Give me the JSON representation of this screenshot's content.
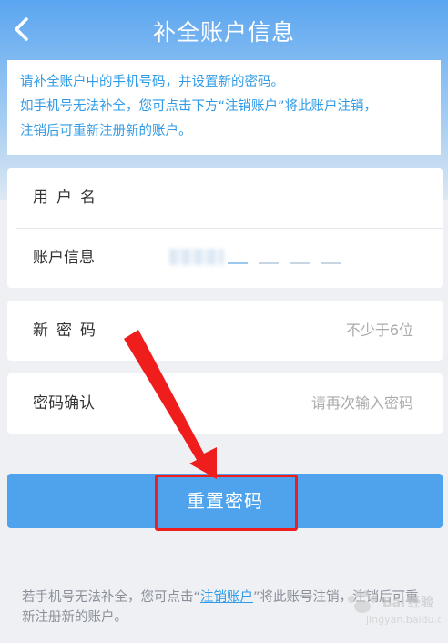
{
  "header": {
    "title": "补全账户信息",
    "back_icon": "chevron-left-icon"
  },
  "notice": {
    "lines": [
      "请补全账户中的手机号码，并设置新的密码。",
      "如手机号无法补全，您可点击下方“注销账户”将此账户注销，",
      "注销后可重新注册新的账户。"
    ]
  },
  "form": {
    "username_label": "用户名",
    "account_info_label": "账户信息",
    "new_password_label": "新密码",
    "new_password_placeholder": "不少于6位",
    "confirm_password_label": "密码确认",
    "confirm_password_placeholder": "请再次输入密码"
  },
  "actions": {
    "reset_label": "重置密码"
  },
  "footer": {
    "text_before": "若手机号无法补全，您可点击“",
    "link_label": "注销账户",
    "text_after": "”将此账号注销，注销后可重新注册新的账户。"
  },
  "colors": {
    "accent": "#4fa3ec",
    "notice_text": "#2f9be6",
    "annotation_red": "#f01d1d"
  }
}
